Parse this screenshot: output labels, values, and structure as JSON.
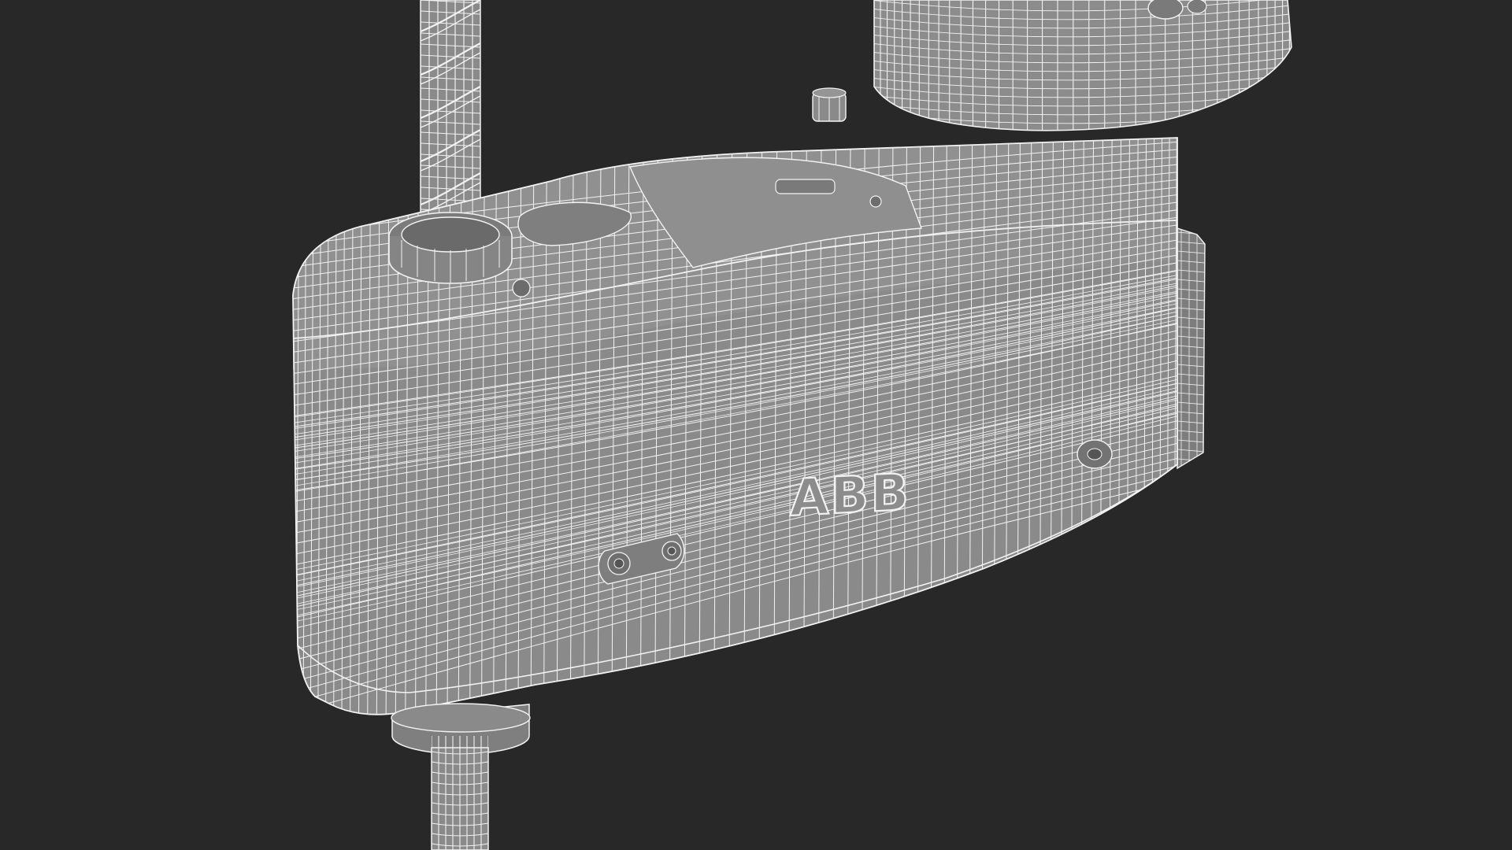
{
  "scene": {
    "subject": "wireframe-render",
    "logo": "ABB"
  },
  "colors": {
    "background": "#282828",
    "surface": "#8a8a8a",
    "surface_dark": "#6f6f6f",
    "surface_light": "#a2a2a2",
    "wire": "#f2f2f2"
  }
}
